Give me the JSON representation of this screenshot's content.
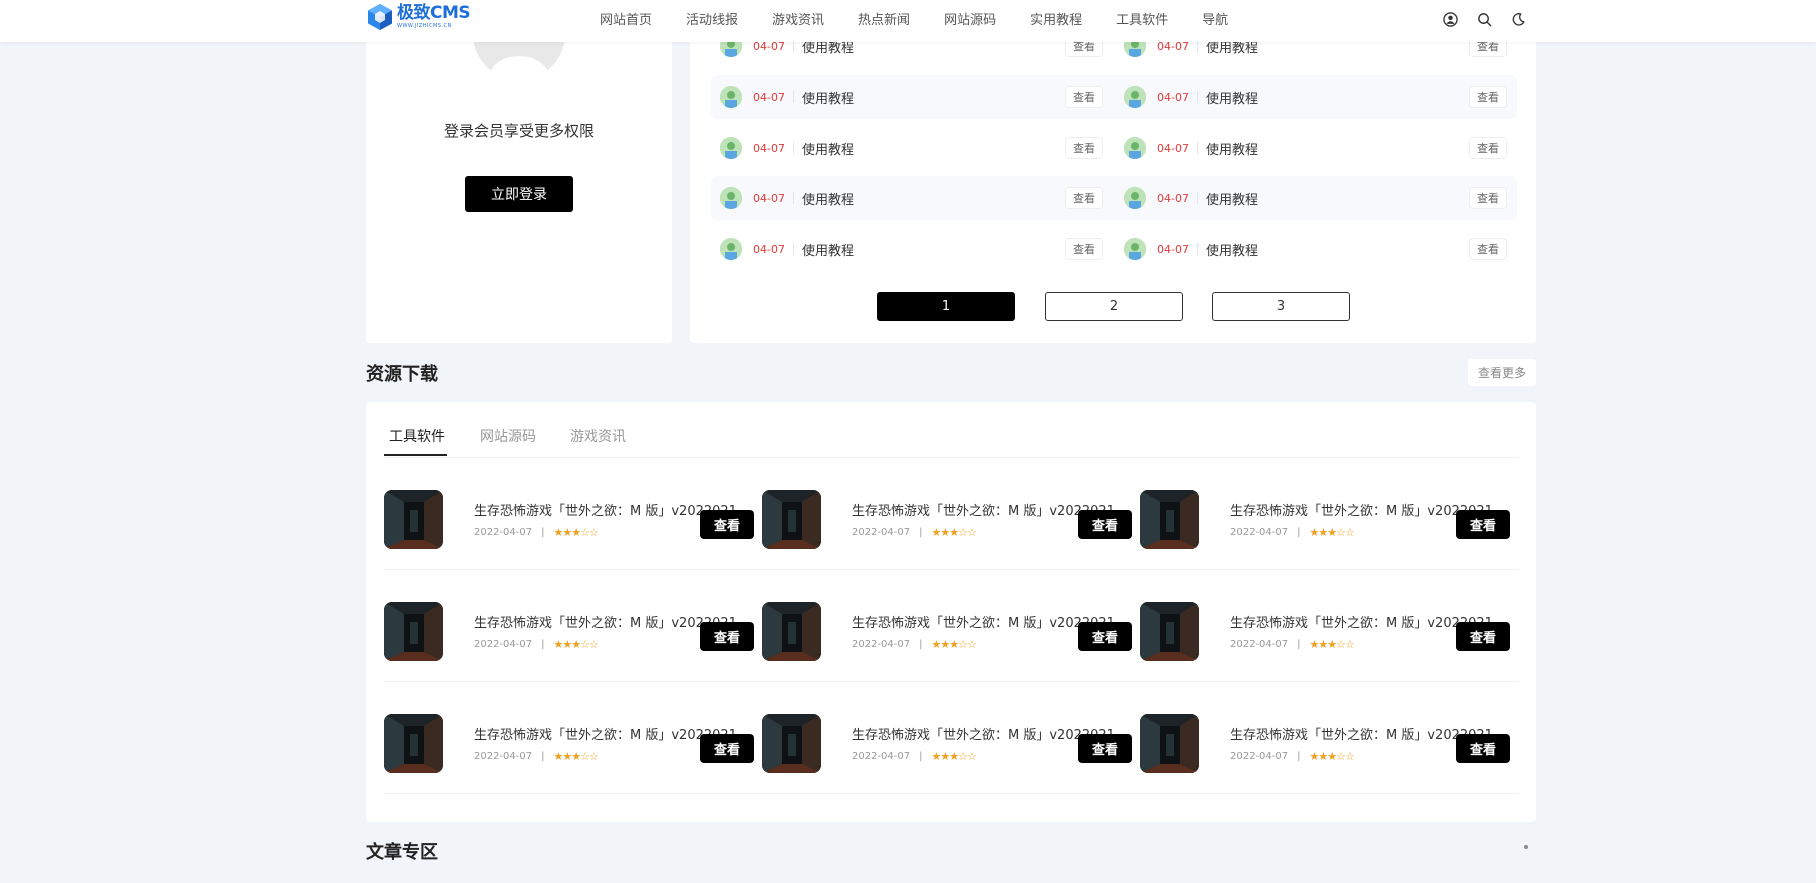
{
  "header": {
    "logo_title": "极致CMS",
    "logo_sub": "WWW.JIZHICMS.CN",
    "nav": [
      "网站首页",
      "活动线报",
      "游戏资讯",
      "热点新闻",
      "网站源码",
      "实用教程",
      "工具软件",
      "导航"
    ]
  },
  "login": {
    "tip": "登录会员享受更多权限",
    "button": "立即登录"
  },
  "tutorials": {
    "rows": [
      [
        {
          "date": "04-07",
          "title": "使用教程",
          "view": "查看"
        },
        {
          "date": "04-07",
          "title": "使用教程",
          "view": "查看"
        }
      ],
      [
        {
          "date": "04-07",
          "title": "使用教程",
          "view": "查看"
        },
        {
          "date": "04-07",
          "title": "使用教程",
          "view": "查看"
        }
      ],
      [
        {
          "date": "04-07",
          "title": "使用教程",
          "view": "查看"
        },
        {
          "date": "04-07",
          "title": "使用教程",
          "view": "查看"
        }
      ],
      [
        {
          "date": "04-07",
          "title": "使用教程",
          "view": "查看"
        },
        {
          "date": "04-07",
          "title": "使用教程",
          "view": "查看"
        }
      ],
      [
        {
          "date": "04-07",
          "title": "使用教程",
          "view": "查看"
        },
        {
          "date": "04-07",
          "title": "使用教程",
          "view": "查看"
        }
      ]
    ],
    "pages": [
      "1",
      "2",
      "3"
    ],
    "active_page": "1"
  },
  "resources": {
    "title": "资源下载",
    "more": "查看更多",
    "tabs": [
      "工具软件",
      "网站源码",
      "游戏资讯"
    ],
    "active_tab": "工具软件",
    "item_title": "生存恐怖游戏「世外之欲：M 版」v2022021...",
    "item_date": "2022-04-07",
    "item_sep": "|",
    "item_rating": 3,
    "item_rating_max": 5,
    "item_button": "查看"
  },
  "articles": {
    "title": "文章专区"
  }
}
